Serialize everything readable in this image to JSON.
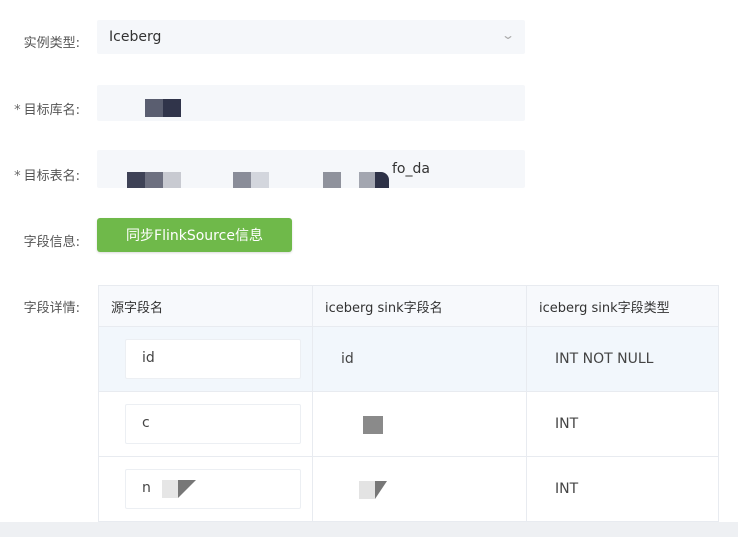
{
  "form": {
    "instance_type": {
      "label": "实例类型:",
      "value": "Iceberg"
    },
    "target_db": {
      "label": "目标库名:",
      "required_mark": "*"
    },
    "target_table": {
      "label": "目标表名:",
      "required_mark": "*",
      "visible_suffix": "fo_da"
    },
    "field_info": {
      "label": "字段信息:",
      "sync_button": "同步FlinkSource信息"
    },
    "field_details": {
      "label": "字段详情:"
    }
  },
  "table": {
    "columns": [
      "源字段名",
      "iceberg sink字段名",
      "iceberg sink字段类型"
    ],
    "rows": [
      {
        "source": "id",
        "sink_name": "id",
        "sink_type": "INT NOT NULL"
      },
      {
        "source": "c",
        "sink_name": "",
        "sink_type": "INT"
      },
      {
        "source": "n",
        "sink_name": "",
        "sink_type": "INT"
      }
    ]
  },
  "colors": {
    "accent_button": "#6fb94a",
    "mask": "#4a4f63",
    "field_bg": "#f5f7fa"
  },
  "icons": {
    "select_dropdown": "chevron-down-icon"
  }
}
